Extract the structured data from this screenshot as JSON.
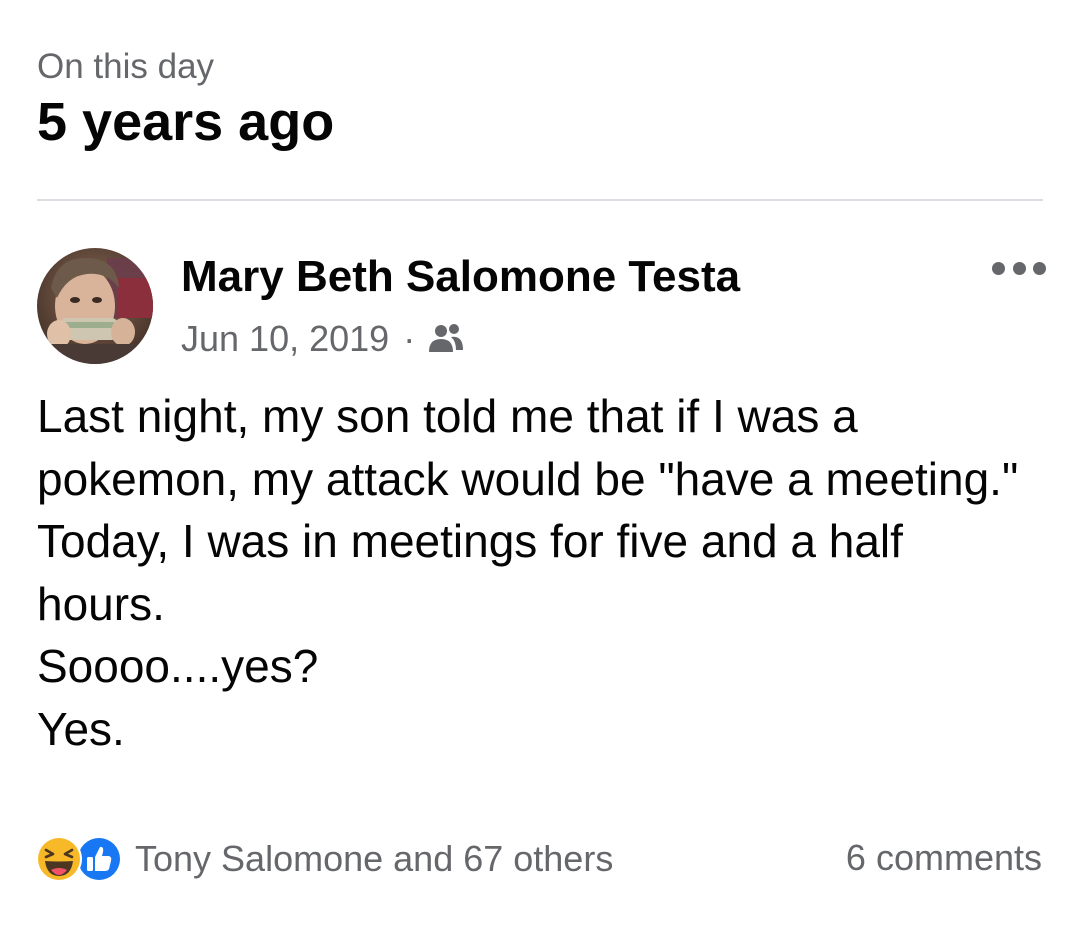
{
  "memory": {
    "subtitle": "On this day",
    "title": "5 years ago"
  },
  "post": {
    "author": "Mary Beth Salomone Testa",
    "date": "Jun 10, 2019",
    "separator": "·",
    "audience_icon": "friends-icon",
    "more_icon": "more-options-icon",
    "body_lines": [
      "Last night, my son told me that if I was a",
      "pokemon, my attack would be \"have a meeting.\"",
      "Today, I was in meetings for five and a half",
      "hours.",
      "Soooo....yes?",
      "Yes."
    ]
  },
  "footer": {
    "reaction_icons": [
      "haha-icon",
      "like-icon"
    ],
    "reactors": "Tony Salomone and 67 others",
    "comments": "6 comments"
  },
  "colors": {
    "text_primary": "#050505",
    "text_secondary": "#65676b",
    "divider": "#dadde1",
    "like_blue": "#1877f2",
    "haha_yellow": "#f7b928"
  }
}
